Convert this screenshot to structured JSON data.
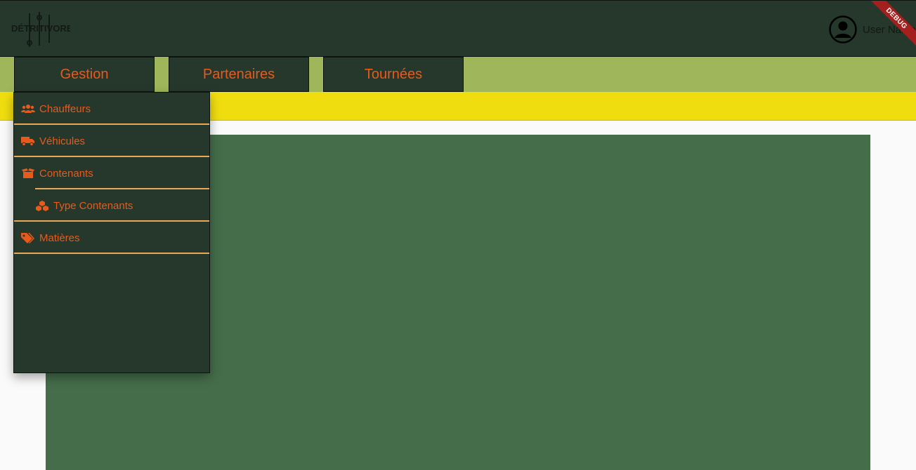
{
  "app": {
    "logo_text": "DÉTRITIVORES",
    "user_name": "User Name",
    "debug_label": "DEBUG"
  },
  "nav": {
    "tabs": [
      {
        "label": "Gestion"
      },
      {
        "label": "Partenaires"
      },
      {
        "label": "Tournées"
      }
    ]
  },
  "menu": {
    "items": [
      {
        "label": "Chauffeurs",
        "icon": "users-icon"
      },
      {
        "label": "Véhicules",
        "icon": "truck-icon"
      },
      {
        "label": "Contenants",
        "icon": "boxes-icon"
      },
      {
        "label": "Type Contenants",
        "icon": "cubes-icon"
      },
      {
        "label": "Matières",
        "icon": "tags-icon"
      }
    ]
  },
  "colors": {
    "header_bg": "#26372b",
    "nav_bg": "#9fb65a",
    "accent_text": "#e85a1c",
    "separator": "#e8a856",
    "banner": "#f0dd10",
    "panel": "#456d4a"
  }
}
